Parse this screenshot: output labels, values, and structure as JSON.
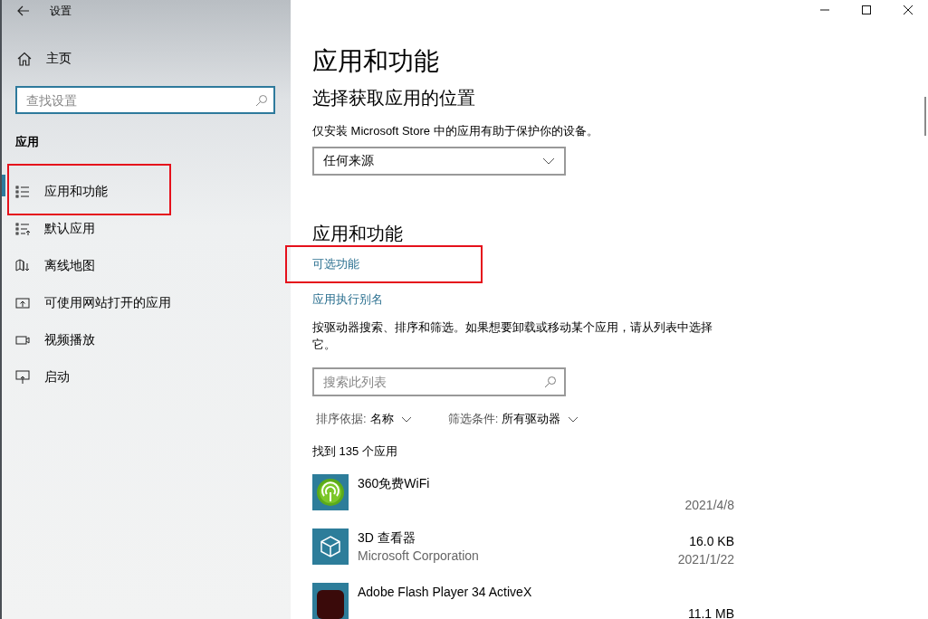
{
  "window": {
    "title": "设置"
  },
  "sidebar": {
    "home": "主页",
    "search": {
      "placeholder": "查找设置"
    },
    "section": "应用",
    "items": [
      {
        "label": "应用和功能",
        "selected": true,
        "highlighted": true
      },
      {
        "label": "默认应用",
        "selected": false,
        "highlighted": false
      },
      {
        "label": "离线地图",
        "selected": false,
        "highlighted": false
      },
      {
        "label": "可使用网站打开的应用",
        "selected": false,
        "highlighted": false
      },
      {
        "label": "视频播放",
        "selected": false,
        "highlighted": false
      },
      {
        "label": "启动",
        "selected": false,
        "highlighted": false
      }
    ]
  },
  "main": {
    "title": "应用和功能",
    "source_heading": "选择获取应用的位置",
    "source_note": "仅安装 Microsoft Store 中的应用有助于保护你的设备。",
    "source_dropdown": "任何来源",
    "apps_heading": "应用和功能",
    "links": [
      {
        "label": "可选功能",
        "highlighted": true
      },
      {
        "label": "应用执行别名",
        "highlighted": false
      }
    ],
    "description": "按驱动器搜索、排序和筛选。如果想要卸载或移动某个应用，请从列表中选择它。",
    "search": {
      "placeholder": "搜索此列表"
    },
    "sort": {
      "label": "排序依据:",
      "value": "名称"
    },
    "filter": {
      "label": "筛选条件:",
      "value": "所有驱动器"
    },
    "count": "找到 135 个应用",
    "apps": [
      {
        "name": "360免费WiFi",
        "date": "2021/4/8"
      },
      {
        "name": "3D 查看器",
        "publisher": "Microsoft Corporation",
        "size": "16.0 KB",
        "date": "2021/1/22"
      },
      {
        "name": "Adobe Flash Player 34 ActiveX",
        "size": "11.1 MB"
      }
    ]
  }
}
